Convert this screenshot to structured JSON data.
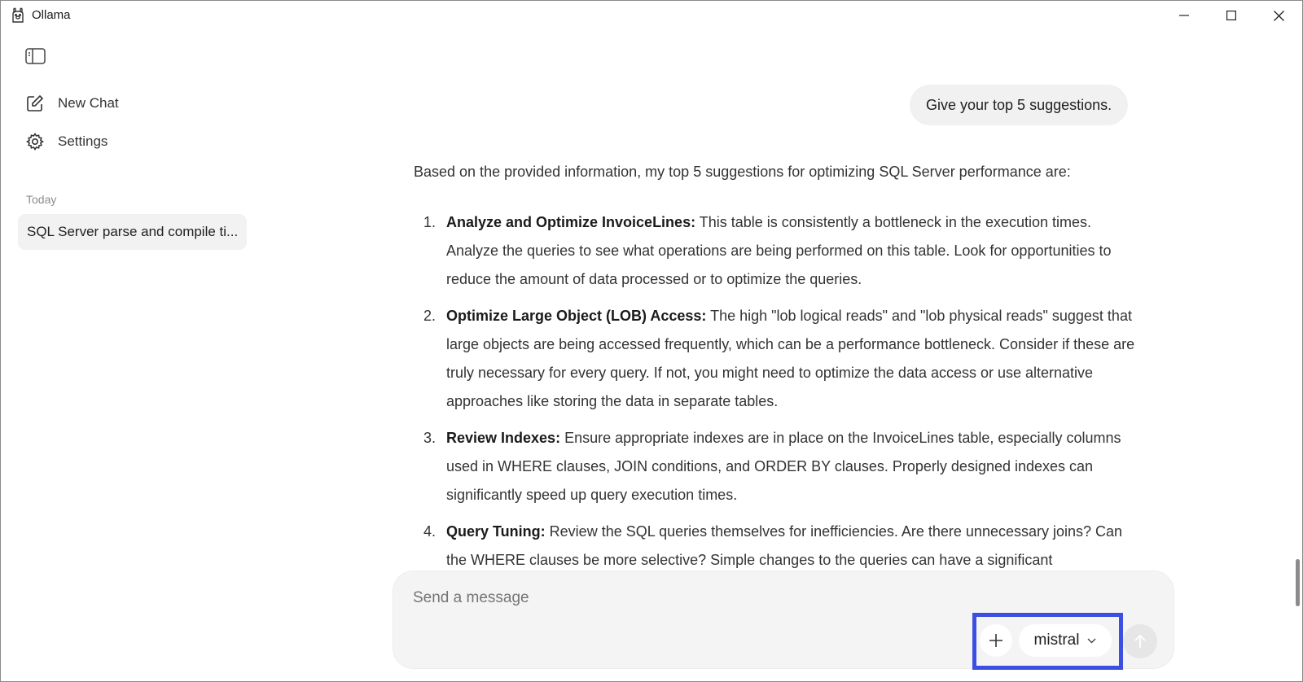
{
  "window": {
    "title": "Ollama",
    "icon": "llama-icon",
    "controls": [
      "minimize-icon",
      "maximize-icon",
      "close-icon"
    ]
  },
  "sidebar": {
    "toggle_icon": "sidebar-toggle-icon",
    "new_chat_label": "New Chat",
    "settings_label": "Settings",
    "section_label": "Today",
    "chats": [
      {
        "title": "SQL Server parse and compile ti..."
      }
    ]
  },
  "conversation": {
    "user_message": "Give your top 5 suggestions.",
    "intro": "Based on the provided information, my top 5 suggestions for optimizing SQL Server performance are:",
    "items": [
      {
        "num": "1.",
        "title": "Analyze and Optimize InvoiceLines:",
        "text": " This table is consistently a bottleneck in the execution times. Analyze the queries to see what operations are being performed on this table. Look for opportunities to reduce the amount of data processed or to optimize the queries."
      },
      {
        "num": "2.",
        "title": "Optimize Large Object (LOB) Access:",
        "text": " The high \"lob logical reads\" and \"lob physical reads\" suggest that large objects are being accessed frequently, which can be a performance bottleneck. Consider if these are truly necessary for every query. If not, you might need to optimize the data access or use alternative approaches like storing the data in separate tables."
      },
      {
        "num": "3.",
        "title": "Review Indexes:",
        "text": " Ensure appropriate indexes are in place on the InvoiceLines table, especially columns used in WHERE clauses, JOIN conditions, and ORDER BY clauses. Properly designed indexes can significantly speed up query execution times."
      },
      {
        "num": "4.",
        "title": "Query Tuning:",
        "text": " Review the SQL queries themselves for inefficiencies. Are there unnecessary joins? Can the WHERE clauses be more selective? Simple changes to the queries can have a significant"
      }
    ]
  },
  "composer": {
    "placeholder": "Send a message",
    "model": "mistral",
    "add_icon": "plus-icon",
    "send_icon": "arrow-up-icon",
    "highlight_color": "#3d4fe0"
  }
}
